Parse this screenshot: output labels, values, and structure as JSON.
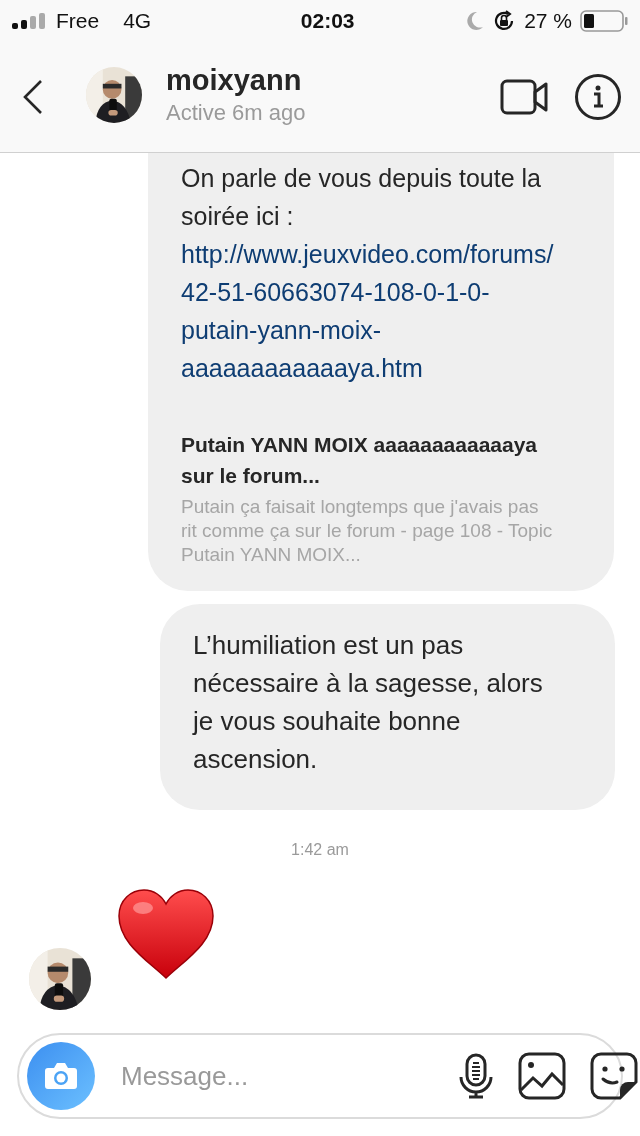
{
  "status_bar": {
    "carrier": "Free",
    "network": "4G",
    "time": "02:03",
    "battery": "27 %"
  },
  "header": {
    "name": "moixyann",
    "status": "Active 6m ago"
  },
  "messages": [
    {
      "kind": "link_share",
      "text": "On parle de vous depuis toute la soirée ici : ",
      "url": "http://www.jeuxvideo.com/forums/42-51-60663074-108-0-1-0-putain-yann-moix-aaaaaaaaaaaaya.htm",
      "preview_title": "Putain YANN MOIX aaaaaaaaaaaaya sur le forum...",
      "preview_description": "Putain ça faisait longtemps que j'avais pas rit comme ça sur le forum - page 108 - Topic Putain YANN MOIX..."
    },
    {
      "kind": "text",
      "text": "L’humiliation est un pas nécessaire à la sagesse, alors je vous souhaite bonne ascension."
    },
    {
      "kind": "timestamp",
      "text": "1:42 am"
    },
    {
      "kind": "heart"
    }
  ],
  "composer": {
    "placeholder": "Message..."
  }
}
